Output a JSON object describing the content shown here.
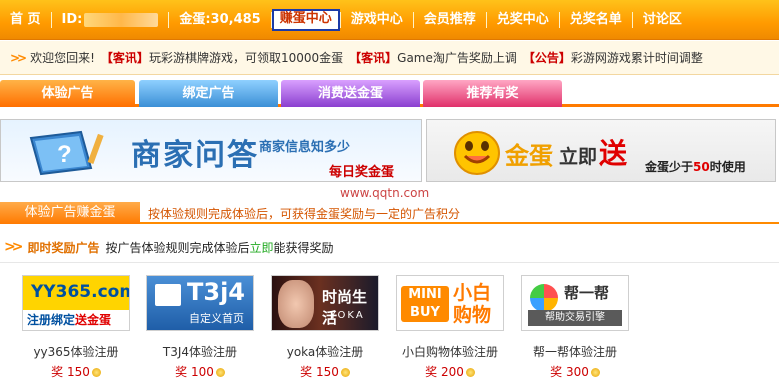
{
  "nav": {
    "home": "首 页",
    "id_label": "ID:",
    "gold": "金蛋:30,485",
    "items": [
      "赚蛋中心",
      "游戏中心",
      "会员推荐",
      "兑奖中心",
      "兑奖名单",
      "讨论区"
    ]
  },
  "announce": {
    "welcome": "欢迎您回来!",
    "items": [
      {
        "tag": "【客讯】",
        "text": "玩彩游棋牌游戏，可领取10000金蛋"
      },
      {
        "tag": "【客讯】",
        "text": "Game淘广告奖励上调"
      },
      {
        "tag": "【公告】",
        "text": "彩游网游戏累计时间调整"
      }
    ]
  },
  "tabs": [
    "体验广告",
    "绑定广告",
    "消费送金蛋",
    "推荐有奖"
  ],
  "banner_left": {
    "title": "商家问答",
    "subtitle": "商家信息知多少",
    "daily": "每日奖金蛋"
  },
  "banner_right": {
    "gold": "金蛋",
    "now": "立即",
    "send": "送",
    "note_pre": "金蛋少于",
    "note_num": "50",
    "note_post": "时使用"
  },
  "watermark": "www.qqtn.com",
  "section": {
    "tab": "体验广告赚金蛋",
    "desc": "按体验规则完成体验后，可获得金蛋奖励与一定的广告积分"
  },
  "instant": {
    "title": "即时奖励广告",
    "desc_pre": "按广告体验规则完成体验后",
    "desc_hl": "立即",
    "desc_post": "能获得奖励"
  },
  "ads": [
    {
      "name": "yy365体验注册",
      "reward_label": "奖",
      "reward": "150",
      "thumb": {
        "big": "YY365.com",
        "strip_a": "注册绑定",
        "strip_b": "送金蛋"
      }
    },
    {
      "name": "T3J4体验注册",
      "reward_label": "奖",
      "reward": "100",
      "thumb": {
        "big": "T3j4",
        "sub": "自定义首页"
      }
    },
    {
      "name": "yoka体验注册",
      "reward_label": "奖",
      "reward": "150",
      "thumb": {
        "big": "时尚生活",
        "sub": "YOKA"
      }
    },
    {
      "name": "小白购物体验注册",
      "reward_label": "奖",
      "reward": "200",
      "thumb": {
        "mini": "MINI BUY",
        "big": "小白 购物"
      }
    },
    {
      "name": "帮一帮体验注册",
      "reward_label": "奖",
      "reward": "300",
      "thumb": {
        "big": "帮一帮",
        "strip": "帮助交易引擎"
      }
    }
  ],
  "colors": {
    "nav": "#ff9a00",
    "accent": "#ff7a00",
    "tab_blue": "#3b8fd6",
    "tab_purple": "#8a3fcf",
    "tab_pink": "#e0306a",
    "reward_red": "#cc0000"
  }
}
